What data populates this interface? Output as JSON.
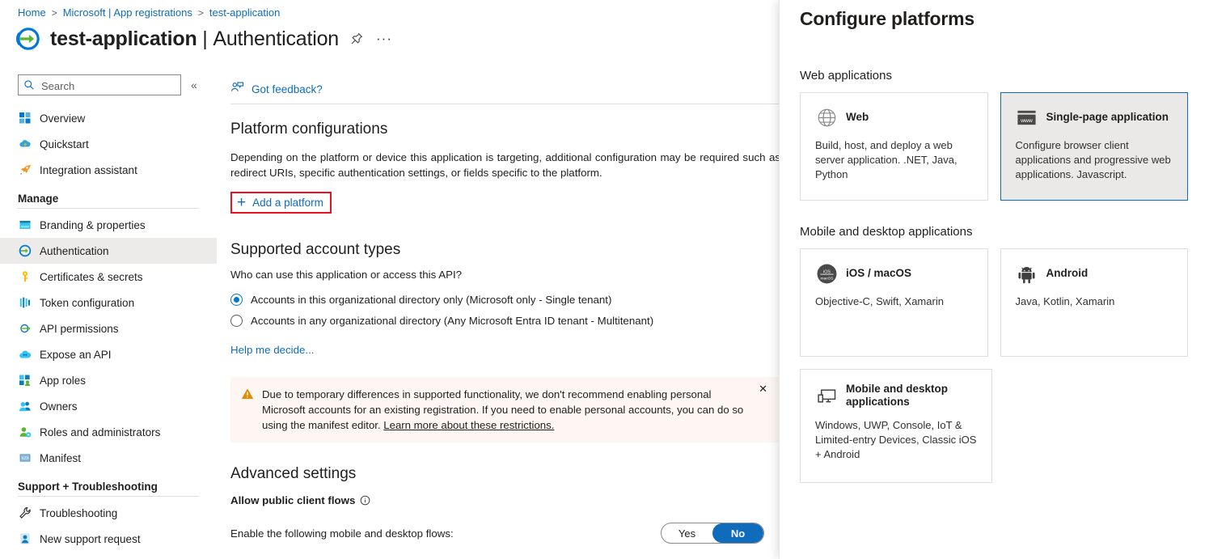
{
  "breadcrumb": {
    "items": [
      {
        "label": "Home",
        "link": true
      },
      {
        "label": "Microsoft | App registrations",
        "link": true
      },
      {
        "label": "test-application",
        "link": true
      }
    ],
    "separator": ">"
  },
  "header": {
    "app_name": "test-application",
    "separator": "|",
    "section": "Authentication",
    "pin_tooltip": "Pin",
    "more_label": "···",
    "logo_icon": "app-registration-icon"
  },
  "sidebar": {
    "search": {
      "value": "",
      "placeholder": "Search",
      "icon": "search-icon"
    },
    "collapse_icon": "chevron-double-left-icon",
    "items": [
      {
        "label": "Overview",
        "icon": "overview-icon",
        "selected": false
      },
      {
        "label": "Quickstart",
        "icon": "quickstart-cloud-icon",
        "selected": false
      },
      {
        "label": "Integration assistant",
        "icon": "rocket-icon",
        "selected": false
      }
    ],
    "groups": [
      {
        "title": "Manage",
        "items": [
          {
            "label": "Branding & properties",
            "icon": "branding-icon",
            "selected": false
          },
          {
            "label": "Authentication",
            "icon": "authentication-icon",
            "selected": true
          },
          {
            "label": "Certificates & secrets",
            "icon": "key-icon",
            "selected": false
          },
          {
            "label": "Token configuration",
            "icon": "token-icon",
            "selected": false
          },
          {
            "label": "API permissions",
            "icon": "api-permissions-icon",
            "selected": false
          },
          {
            "label": "Expose an API",
            "icon": "expose-api-icon",
            "selected": false
          },
          {
            "label": "App roles",
            "icon": "app-roles-icon",
            "selected": false
          },
          {
            "label": "Owners",
            "icon": "owners-icon",
            "selected": false
          },
          {
            "label": "Roles and administrators",
            "icon": "roles-admin-icon",
            "selected": false
          },
          {
            "label": "Manifest",
            "icon": "manifest-icon",
            "selected": false
          }
        ]
      },
      {
        "title": "Support + Troubleshooting",
        "items": [
          {
            "label": "Troubleshooting",
            "icon": "wrench-icon",
            "selected": false
          },
          {
            "label": "New support request",
            "icon": "support-person-icon",
            "selected": false
          }
        ]
      }
    ]
  },
  "command_bar": {
    "feedback_label": "Got feedback?",
    "feedback_icon": "feedback-person-icon"
  },
  "main": {
    "platform_configurations": {
      "heading": "Platform configurations",
      "description": "Depending on the platform or device this application is targeting, additional configuration may be required such as redirect URIs, specific authentication settings, or fields specific to the platform.",
      "add_platform_label": "Add a platform",
      "add_platform_icon": "plus-icon",
      "highlight_color": "#e81123"
    },
    "supported_account_types": {
      "heading": "Supported account types",
      "question": "Who can use this application or access this API?",
      "options": [
        {
          "label": "Accounts in this organizational directory only (Microsoft only - Single tenant)",
          "checked": true
        },
        {
          "label": "Accounts in any organizational directory (Any Microsoft Entra ID tenant - Multitenant)",
          "checked": false
        }
      ],
      "help_link": "Help me decide..."
    },
    "warning": {
      "icon": "warning-triangle-icon",
      "text": "Due to temporary differences in supported functionality, we don't recommend enabling personal Microsoft accounts for an existing registration. If you need to enable personal accounts, you can do so using the manifest editor. ",
      "link_text": "Learn more about these restrictions.",
      "close_icon": "close-icon",
      "background": "#fdf6f3"
    },
    "advanced_settings": {
      "heading": "Advanced settings",
      "allow_public_client_flows_label": "Allow public client flows",
      "info_icon": "info-icon",
      "flows_label": "Enable the following mobile and desktop flows:",
      "toggle": {
        "yes_label": "Yes",
        "no_label": "No",
        "value": "No",
        "accent": "#0f6cbd"
      }
    }
  },
  "panel": {
    "title": "Configure platforms",
    "sections": [
      {
        "title": "Web applications",
        "cards": [
          {
            "title": "Web",
            "description": "Build, host, and deploy a web server application. .NET, Java, Python",
            "icon": "globe-icon",
            "selected": false
          },
          {
            "title": "Single-page application",
            "description": "Configure browser client applications and progressive web applications. Javascript.",
            "icon": "www-window-icon",
            "selected": true
          }
        ]
      },
      {
        "title": "Mobile and desktop applications",
        "cards": [
          {
            "title": "iOS / macOS",
            "description": "Objective-C, Swift, Xamarin",
            "icon": "ios-macos-icon",
            "selected": false
          },
          {
            "title": "Android",
            "description": "Java, Kotlin, Xamarin",
            "icon": "android-icon",
            "selected": false
          },
          {
            "title": "Mobile and desktop applications",
            "description": "Windows, UWP, Console, IoT & Limited-entry Devices, Classic iOS + Android",
            "icon": "desktop-mobile-icon",
            "selected": false
          }
        ]
      }
    ]
  }
}
